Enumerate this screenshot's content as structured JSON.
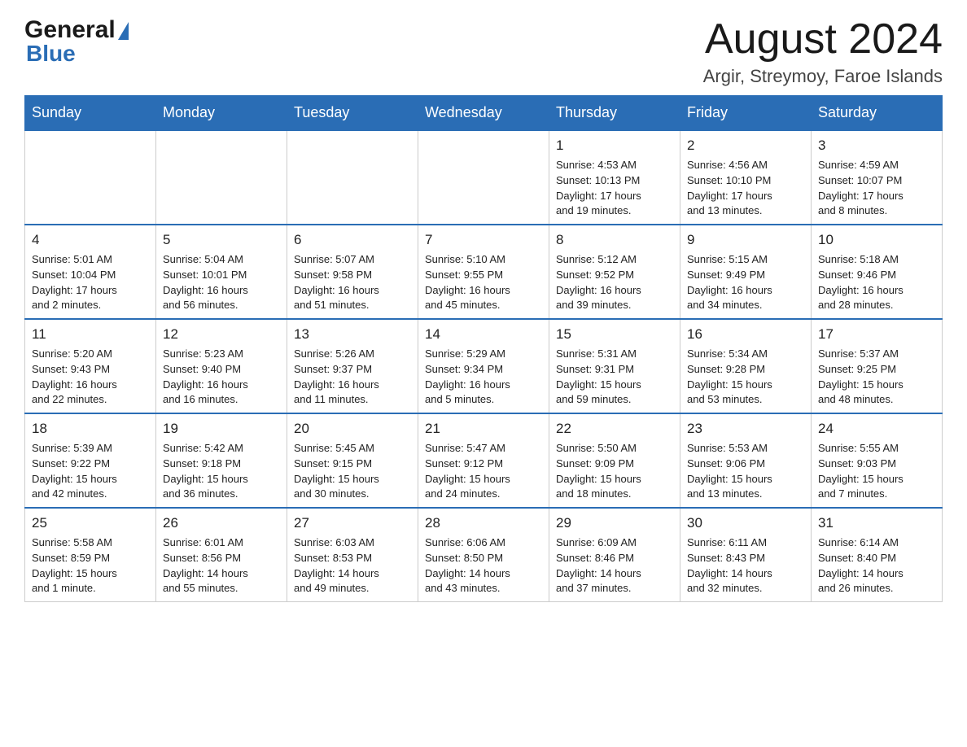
{
  "header": {
    "logo_general": "General",
    "logo_blue": "Blue",
    "month_title": "August 2024",
    "location": "Argir, Streymoy, Faroe Islands"
  },
  "weekdays": [
    "Sunday",
    "Monday",
    "Tuesday",
    "Wednesday",
    "Thursday",
    "Friday",
    "Saturday"
  ],
  "weeks": [
    [
      {
        "day": "",
        "info": ""
      },
      {
        "day": "",
        "info": ""
      },
      {
        "day": "",
        "info": ""
      },
      {
        "day": "",
        "info": ""
      },
      {
        "day": "1",
        "info": "Sunrise: 4:53 AM\nSunset: 10:13 PM\nDaylight: 17 hours\nand 19 minutes."
      },
      {
        "day": "2",
        "info": "Sunrise: 4:56 AM\nSunset: 10:10 PM\nDaylight: 17 hours\nand 13 minutes."
      },
      {
        "day": "3",
        "info": "Sunrise: 4:59 AM\nSunset: 10:07 PM\nDaylight: 17 hours\nand 8 minutes."
      }
    ],
    [
      {
        "day": "4",
        "info": "Sunrise: 5:01 AM\nSunset: 10:04 PM\nDaylight: 17 hours\nand 2 minutes."
      },
      {
        "day": "5",
        "info": "Sunrise: 5:04 AM\nSunset: 10:01 PM\nDaylight: 16 hours\nand 56 minutes."
      },
      {
        "day": "6",
        "info": "Sunrise: 5:07 AM\nSunset: 9:58 PM\nDaylight: 16 hours\nand 51 minutes."
      },
      {
        "day": "7",
        "info": "Sunrise: 5:10 AM\nSunset: 9:55 PM\nDaylight: 16 hours\nand 45 minutes."
      },
      {
        "day": "8",
        "info": "Sunrise: 5:12 AM\nSunset: 9:52 PM\nDaylight: 16 hours\nand 39 minutes."
      },
      {
        "day": "9",
        "info": "Sunrise: 5:15 AM\nSunset: 9:49 PM\nDaylight: 16 hours\nand 34 minutes."
      },
      {
        "day": "10",
        "info": "Sunrise: 5:18 AM\nSunset: 9:46 PM\nDaylight: 16 hours\nand 28 minutes."
      }
    ],
    [
      {
        "day": "11",
        "info": "Sunrise: 5:20 AM\nSunset: 9:43 PM\nDaylight: 16 hours\nand 22 minutes."
      },
      {
        "day": "12",
        "info": "Sunrise: 5:23 AM\nSunset: 9:40 PM\nDaylight: 16 hours\nand 16 minutes."
      },
      {
        "day": "13",
        "info": "Sunrise: 5:26 AM\nSunset: 9:37 PM\nDaylight: 16 hours\nand 11 minutes."
      },
      {
        "day": "14",
        "info": "Sunrise: 5:29 AM\nSunset: 9:34 PM\nDaylight: 16 hours\nand 5 minutes."
      },
      {
        "day": "15",
        "info": "Sunrise: 5:31 AM\nSunset: 9:31 PM\nDaylight: 15 hours\nand 59 minutes."
      },
      {
        "day": "16",
        "info": "Sunrise: 5:34 AM\nSunset: 9:28 PM\nDaylight: 15 hours\nand 53 minutes."
      },
      {
        "day": "17",
        "info": "Sunrise: 5:37 AM\nSunset: 9:25 PM\nDaylight: 15 hours\nand 48 minutes."
      }
    ],
    [
      {
        "day": "18",
        "info": "Sunrise: 5:39 AM\nSunset: 9:22 PM\nDaylight: 15 hours\nand 42 minutes."
      },
      {
        "day": "19",
        "info": "Sunrise: 5:42 AM\nSunset: 9:18 PM\nDaylight: 15 hours\nand 36 minutes."
      },
      {
        "day": "20",
        "info": "Sunrise: 5:45 AM\nSunset: 9:15 PM\nDaylight: 15 hours\nand 30 minutes."
      },
      {
        "day": "21",
        "info": "Sunrise: 5:47 AM\nSunset: 9:12 PM\nDaylight: 15 hours\nand 24 minutes."
      },
      {
        "day": "22",
        "info": "Sunrise: 5:50 AM\nSunset: 9:09 PM\nDaylight: 15 hours\nand 18 minutes."
      },
      {
        "day": "23",
        "info": "Sunrise: 5:53 AM\nSunset: 9:06 PM\nDaylight: 15 hours\nand 13 minutes."
      },
      {
        "day": "24",
        "info": "Sunrise: 5:55 AM\nSunset: 9:03 PM\nDaylight: 15 hours\nand 7 minutes."
      }
    ],
    [
      {
        "day": "25",
        "info": "Sunrise: 5:58 AM\nSunset: 8:59 PM\nDaylight: 15 hours\nand 1 minute."
      },
      {
        "day": "26",
        "info": "Sunrise: 6:01 AM\nSunset: 8:56 PM\nDaylight: 14 hours\nand 55 minutes."
      },
      {
        "day": "27",
        "info": "Sunrise: 6:03 AM\nSunset: 8:53 PM\nDaylight: 14 hours\nand 49 minutes."
      },
      {
        "day": "28",
        "info": "Sunrise: 6:06 AM\nSunset: 8:50 PM\nDaylight: 14 hours\nand 43 minutes."
      },
      {
        "day": "29",
        "info": "Sunrise: 6:09 AM\nSunset: 8:46 PM\nDaylight: 14 hours\nand 37 minutes."
      },
      {
        "day": "30",
        "info": "Sunrise: 6:11 AM\nSunset: 8:43 PM\nDaylight: 14 hours\nand 32 minutes."
      },
      {
        "day": "31",
        "info": "Sunrise: 6:14 AM\nSunset: 8:40 PM\nDaylight: 14 hours\nand 26 minutes."
      }
    ]
  ]
}
